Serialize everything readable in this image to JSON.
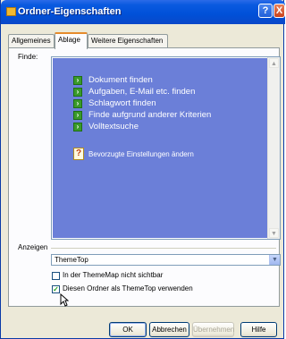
{
  "window": {
    "title": "Ordner-Eigenschaften",
    "help_glyph": "?",
    "close_glyph": "X"
  },
  "tabs": [
    {
      "label": "Allgemeines",
      "active": false
    },
    {
      "label": "Ablage",
      "active": true
    },
    {
      "label": "Weitere Eigenschaften",
      "active": false
    }
  ],
  "finde": {
    "label": "Finde:",
    "tasks": [
      {
        "label": "Dokument finden",
        "icon": "green-arrow-icon"
      },
      {
        "label": "Aufgaben, E-Mail etc. finden",
        "icon": "green-arrow-icon"
      },
      {
        "label": "Schlagwort finden",
        "icon": "green-arrow-icon"
      },
      {
        "label": "Finde aufgrund anderer Kriterien",
        "icon": "green-arrow-icon"
      },
      {
        "label": "Volltextsuche",
        "icon": "green-arrow-icon"
      }
    ],
    "settings_link": "Bevorzugte Einstellungen ändern",
    "background_color": "#6b7fd8"
  },
  "anzeigen": {
    "label": "Anzeigen",
    "selected": "ThemeTop"
  },
  "checkboxes": [
    {
      "label": "In der ThemeMap nicht sichtbar",
      "checked": false
    },
    {
      "label": "Diesen Ordner als ThemeTop verwenden",
      "checked": true
    }
  ],
  "buttons": {
    "ok": "OK",
    "cancel": "Abbrechen",
    "apply": "Übernehmen",
    "help": "Hilfe"
  }
}
